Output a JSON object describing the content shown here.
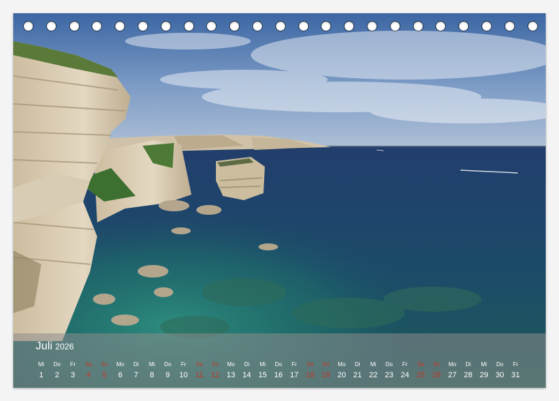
{
  "calendar": {
    "month": "Juli",
    "year": "2026",
    "days": [
      {
        "wd": "Mi",
        "d": "1",
        "weekend": false
      },
      {
        "wd": "Do",
        "d": "2",
        "weekend": false
      },
      {
        "wd": "Fr",
        "d": "3",
        "weekend": false
      },
      {
        "wd": "Sa",
        "d": "4",
        "weekend": true
      },
      {
        "wd": "So",
        "d": "5",
        "weekend": true
      },
      {
        "wd": "Mo",
        "d": "6",
        "weekend": false
      },
      {
        "wd": "Di",
        "d": "7",
        "weekend": false
      },
      {
        "wd": "Mi",
        "d": "8",
        "weekend": false
      },
      {
        "wd": "Do",
        "d": "9",
        "weekend": false
      },
      {
        "wd": "Fr",
        "d": "10",
        "weekend": false
      },
      {
        "wd": "Sa",
        "d": "11",
        "weekend": true
      },
      {
        "wd": "So",
        "d": "12",
        "weekend": true
      },
      {
        "wd": "Mo",
        "d": "13",
        "weekend": false
      },
      {
        "wd": "Di",
        "d": "14",
        "weekend": false
      },
      {
        "wd": "Mi",
        "d": "15",
        "weekend": false
      },
      {
        "wd": "Do",
        "d": "16",
        "weekend": false
      },
      {
        "wd": "Fr",
        "d": "17",
        "weekend": false
      },
      {
        "wd": "Sa",
        "d": "18",
        "weekend": true
      },
      {
        "wd": "So",
        "d": "19",
        "weekend": true
      },
      {
        "wd": "Mo",
        "d": "20",
        "weekend": false
      },
      {
        "wd": "Di",
        "d": "21",
        "weekend": false
      },
      {
        "wd": "Mi",
        "d": "22",
        "weekend": false
      },
      {
        "wd": "Do",
        "d": "23",
        "weekend": false
      },
      {
        "wd": "Fr",
        "d": "24",
        "weekend": false
      },
      {
        "wd": "Sa",
        "d": "25",
        "weekend": true
      },
      {
        "wd": "So",
        "d": "26",
        "weekend": true
      },
      {
        "wd": "Mo",
        "d": "27",
        "weekend": false
      },
      {
        "wd": "Di",
        "d": "28",
        "weekend": false
      },
      {
        "wd": "Mi",
        "d": "29",
        "weekend": false
      },
      {
        "wd": "Do",
        "d": "30",
        "weekend": false
      },
      {
        "wd": "Fr",
        "d": "31",
        "weekend": false
      }
    ]
  },
  "colors": {
    "sky_top": "#3e6aa8",
    "sky_bottom": "#9fb6d3",
    "sea_deep": "#1f3f72",
    "sea_shallow": "#1f7d74",
    "cliff": "#d9ccb3",
    "weekend": "#c0392b"
  }
}
